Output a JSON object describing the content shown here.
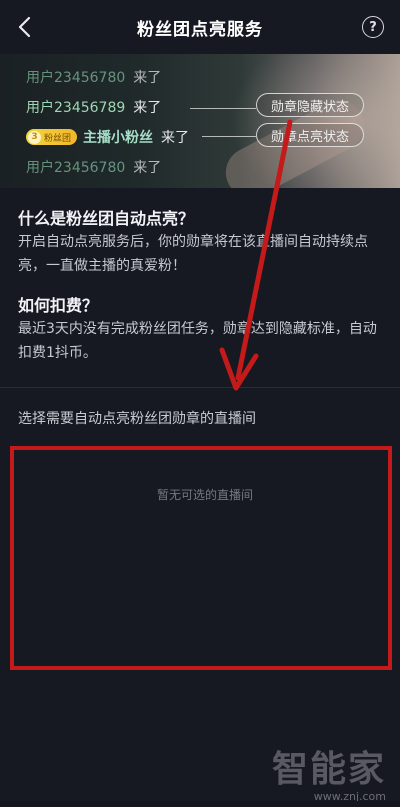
{
  "header": {
    "title": "粉丝团点亮服务",
    "help_glyph": "?"
  },
  "banner": {
    "messages": [
      {
        "user": "用户23456780",
        "suffix": "来了"
      },
      {
        "user": "用户23456789",
        "suffix": "来了"
      },
      {
        "badge_level": "3",
        "badge_text": "粉丝团",
        "user": "主播小粉丝",
        "suffix": "来了"
      },
      {
        "user": "用户23456780",
        "suffix": "来了"
      }
    ],
    "pill_hidden": "勋章隐藏状态",
    "pill_lit": "勋章点亮状态"
  },
  "info": {
    "what_title": "什么是粉丝团自动点亮？",
    "what_body": "开启自动点亮服务后，你的勋章将在该直播间自动持续点亮，一直做主播的真爱粉！",
    "fee_title": "如何扣费？",
    "fee_body": "最近3天内没有完成粉丝团任务，勋章达到隐藏标准，自动扣费1抖币。"
  },
  "selection": {
    "label": "选择需要自动点亮粉丝团勋章的直播间",
    "empty_text": "暂无可选的直播间"
  },
  "watermark": {
    "logo": "智能家",
    "url": "www.znj.com"
  },
  "colors": {
    "background": "#171922",
    "annotation_red": "#c41a1a"
  }
}
